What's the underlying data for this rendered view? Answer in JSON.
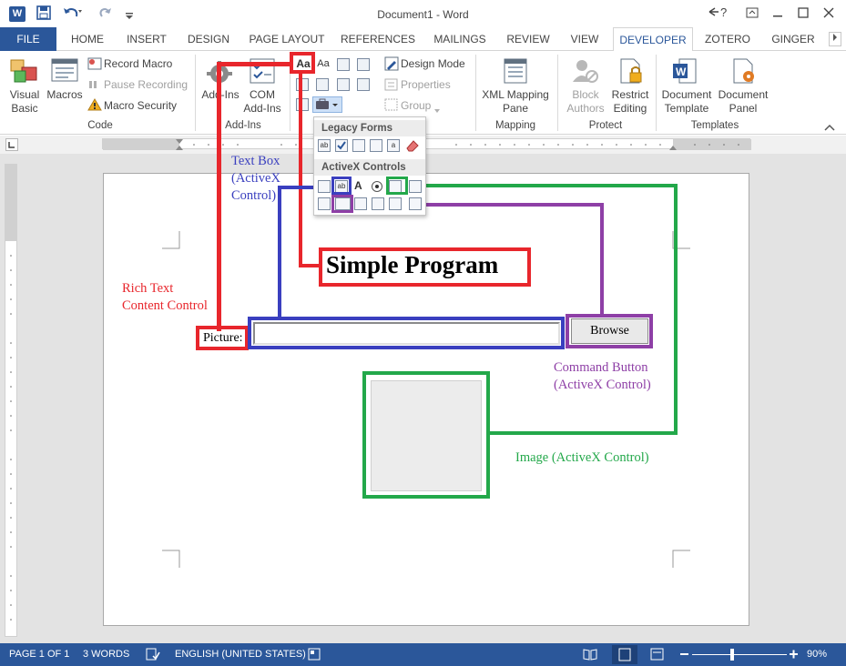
{
  "window": {
    "title": "Document1 - Word",
    "app_icon": "W",
    "help": "?",
    "controls": [
      "restore-ribbon",
      "minimize",
      "maximize",
      "close"
    ]
  },
  "qat": {
    "save": "save-icon",
    "undo": "undo-icon",
    "redo": "redo-icon",
    "customize": "customize-icon"
  },
  "tabs": [
    {
      "label": "FILE"
    },
    {
      "label": "HOME"
    },
    {
      "label": "INSERT"
    },
    {
      "label": "DESIGN"
    },
    {
      "label": "PAGE LAYOUT"
    },
    {
      "label": "REFERENCES"
    },
    {
      "label": "MAILINGS"
    },
    {
      "label": "REVIEW"
    },
    {
      "label": "VIEW"
    },
    {
      "label": "DEVELOPER"
    },
    {
      "label": "ZOTERO"
    },
    {
      "label": "GINGER"
    }
  ],
  "active_tab": "DEVELOPER",
  "ribbon": {
    "code": {
      "label": "Code",
      "visual_basic": "Visual\nBasic",
      "macros": "Macros",
      "record_macro": "Record Macro",
      "pause_recording": "Pause Recording",
      "macro_security": "Macro Security"
    },
    "addins": {
      "label": "Add-Ins",
      "addins": "Add-Ins",
      "com_addins": "COM\nAdd-Ins"
    },
    "controls": {
      "design_mode": "Design Mode",
      "properties": "Properties",
      "group": "Group"
    },
    "mapping": {
      "label": "Mapping",
      "xml_mapping_pane": "XML Mapping\nPane"
    },
    "protect": {
      "label": "Protect",
      "block_authors": "Block\nAuthors",
      "restrict_editing": "Restrict\nEditing"
    },
    "templates": {
      "label": "Templates",
      "document_template": "Document\nTemplate",
      "document_panel": "Document\nPanel"
    }
  },
  "dropdown": {
    "legacy_forms": "Legacy Forms",
    "activex_controls": "ActiveX Controls"
  },
  "document": {
    "heading": "Simple Program",
    "picture_label": "Picture:",
    "browse_button": "Browse"
  },
  "annotations": {
    "text_box": "Text Box\n(ActiveX\nControl)",
    "rich_text": "Rich Text\nContent Control",
    "command_button": "Command Button\n(ActiveX Control)",
    "image": "Image (ActiveX Control)"
  },
  "colors": {
    "red": "#e8262c",
    "blue": "#3a3fbf",
    "purple": "#8e3fa6",
    "green": "#23a84a",
    "word_blue": "#2b579a"
  },
  "status": {
    "page": "PAGE 1 OF 1",
    "words": "3 WORDS",
    "language": "ENGLISH (UNITED STATES)",
    "zoom": "90%"
  }
}
